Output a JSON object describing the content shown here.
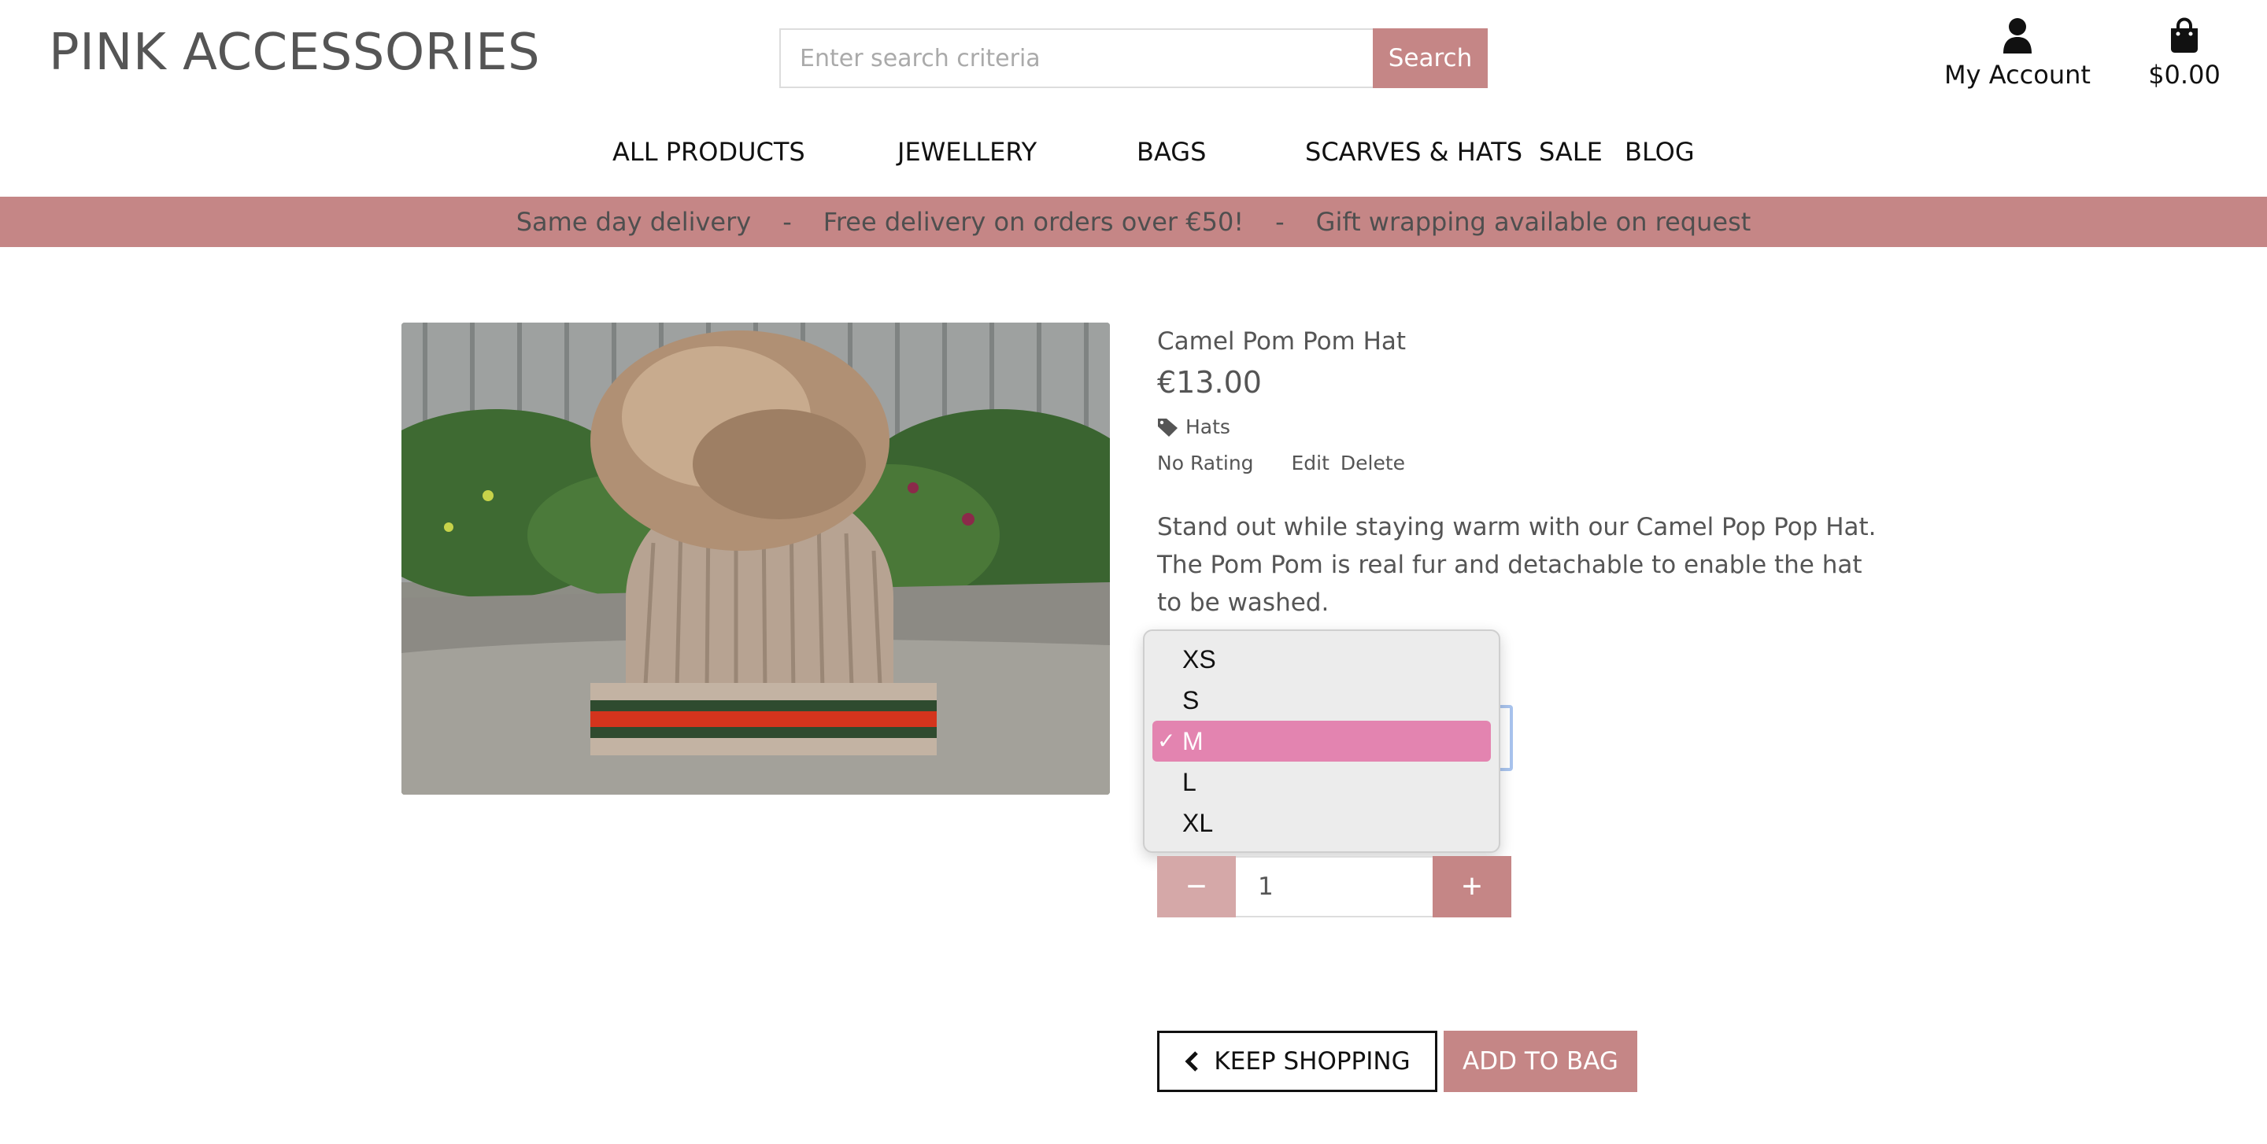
{
  "header": {
    "logo": "PINK ACCESSORIES",
    "search_placeholder": "Enter search criteria",
    "search_button": "Search",
    "account_label": "My Account",
    "bag_total": "$0.00"
  },
  "nav": {
    "items": [
      "ALL PRODUCTS",
      "JEWELLERY",
      "BAGS",
      "SCARVES & HATS",
      "SALE",
      "BLOG"
    ]
  },
  "banner": {
    "messages": [
      "Same day delivery",
      "Free delivery on orders over €50!",
      "Gift wrapping available on request"
    ],
    "separator": "-"
  },
  "product": {
    "name": "Camel Pom Pom Hat",
    "price": "€13.00",
    "category": "Hats",
    "rating": "No Rating",
    "edit_label": "Edit",
    "delete_label": "Delete",
    "description": "Stand out while staying warm with our Camel Pop Pop Hat. The Pom Pom is real fur and detachable to enable the hat to be washed."
  },
  "size_select": {
    "options": [
      "XS",
      "S",
      "M",
      "L",
      "XL"
    ],
    "selected": "M",
    "check_mark": "✓"
  },
  "quantity": {
    "value": "1",
    "minus_label": "−",
    "plus_label": "+"
  },
  "actions": {
    "keep_shopping": "KEEP SHOPPING",
    "add_to_bag": "ADD TO BAG"
  },
  "colors": {
    "brand_pink": "#c58686",
    "brand_pink_light": "#d5a8a8",
    "selected_option": "#e384b0"
  }
}
